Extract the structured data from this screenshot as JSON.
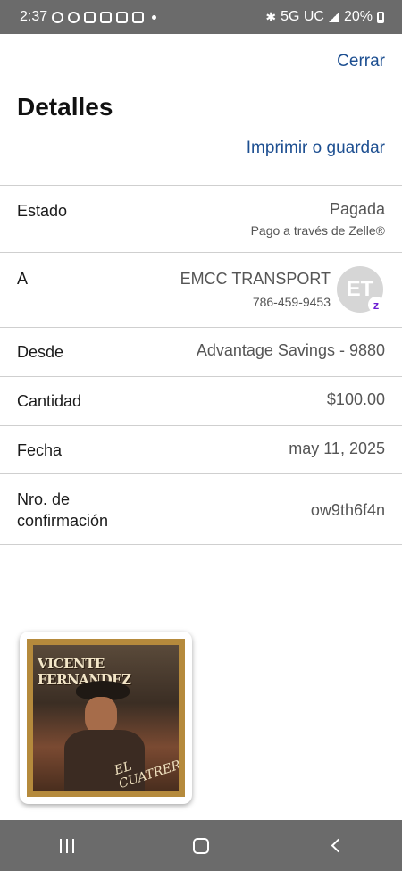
{
  "status_bar": {
    "time": "2:37",
    "network": "5G UC",
    "battery": "20%"
  },
  "header": {
    "close_label": "Cerrar",
    "title": "Detalles",
    "print_label": "Imprimir o guardar"
  },
  "details": {
    "estado": {
      "label": "Estado",
      "value": "Pagada",
      "sub": "Pago a través de Zelle®"
    },
    "recipient": {
      "label": "A",
      "name": "EMCC TRANSPORT",
      "phone": "786-459-9453",
      "initials": "ET",
      "badge": "z"
    },
    "desde": {
      "label": "Desde",
      "value": "Advantage Savings - 9880"
    },
    "cantidad": {
      "label": "Cantidad",
      "value": "$100.00"
    },
    "fecha": {
      "label": "Fecha",
      "value": "may 11, 2025"
    },
    "confirmacion": {
      "label_line1": "Nro. de",
      "label_line2": "confirmación",
      "value": "ow9th6f4n"
    }
  },
  "attachment": {
    "album_title": "VICENTE FERNANDEZ",
    "album_subtitle": "EL CUATRERO"
  },
  "colors": {
    "link": "#1d4f91",
    "system_bars": "#6b6b6b",
    "avatar_bg": "#d6d6d6",
    "zelle_purple": "#6d1ed4"
  }
}
